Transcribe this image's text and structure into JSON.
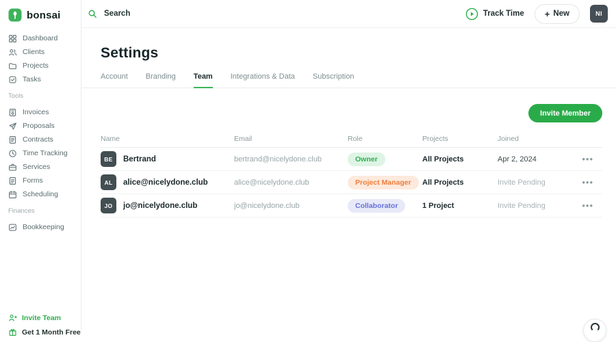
{
  "brand": {
    "name": "bonsai"
  },
  "sidebar": {
    "sections": [
      {
        "items": [
          {
            "label": "Dashboard",
            "icon": "grid-icon"
          },
          {
            "label": "Clients",
            "icon": "people-icon"
          },
          {
            "label": "Projects",
            "icon": "folder-icon"
          },
          {
            "label": "Tasks",
            "icon": "task-check-icon"
          }
        ]
      },
      {
        "label": "Tools",
        "items": [
          {
            "label": "Invoices",
            "icon": "invoice-icon"
          },
          {
            "label": "Proposals",
            "icon": "paper-plane-icon"
          },
          {
            "label": "Contracts",
            "icon": "document-icon"
          },
          {
            "label": "Time Tracking",
            "icon": "clock-icon"
          },
          {
            "label": "Services",
            "icon": "briefcase-icon"
          },
          {
            "label": "Forms",
            "icon": "form-icon"
          },
          {
            "label": "Scheduling",
            "icon": "calendar-icon"
          }
        ]
      },
      {
        "label": "Finances",
        "items": [
          {
            "label": "Bookkeeping",
            "icon": "chart-icon"
          }
        ]
      }
    ],
    "footer": {
      "invite_team": "Invite Team",
      "promo": "Get 1 Month Free"
    }
  },
  "topbar": {
    "search_placeholder": "Search",
    "track_time_label": "Track Time",
    "new_button_label": "New",
    "avatar_initials": "NI"
  },
  "page": {
    "title": "Settings",
    "tabs": [
      {
        "label": "Account",
        "active": false
      },
      {
        "label": "Branding",
        "active": false
      },
      {
        "label": "Team",
        "active": true
      },
      {
        "label": "Integrations & Data",
        "active": false
      },
      {
        "label": "Subscription",
        "active": false
      }
    ],
    "invite_member_label": "Invite Member"
  },
  "team_table": {
    "columns": [
      "Name",
      "Email",
      "Role",
      "Projects",
      "Joined"
    ],
    "rows": [
      {
        "initials": "BE",
        "name": "Bertrand",
        "email": "bertrand@nicelydone.club",
        "role": "Owner",
        "role_color": "green",
        "projects": "All Projects",
        "joined": "Apr 2, 2024"
      },
      {
        "initials": "AL",
        "name": "alice@nicelydone.club",
        "email": "alice@nicelydone.club",
        "role": "Project Manager",
        "role_color": "orange",
        "projects": "All Projects",
        "joined": "Invite Pending"
      },
      {
        "initials": "JO",
        "name": "jo@nicelydone.club",
        "email": "jo@nicelydone.club",
        "role": "Collaborator",
        "role_color": "purple",
        "projects": "1 Project",
        "joined": "Invite Pending"
      }
    ],
    "row_menu_glyph": "•••"
  },
  "colors": {
    "accent_green": "#2fae4e",
    "button_green": "#2aab49",
    "avatar_bg": "#454e54",
    "role_owner": "#2fae52",
    "role_owner_bg": "#def4e4",
    "role_pm": "#ee7e3e",
    "role_pm_bg": "#fdeadc",
    "role_collab": "#6570d8",
    "role_collab_bg": "#e7e9f8"
  }
}
